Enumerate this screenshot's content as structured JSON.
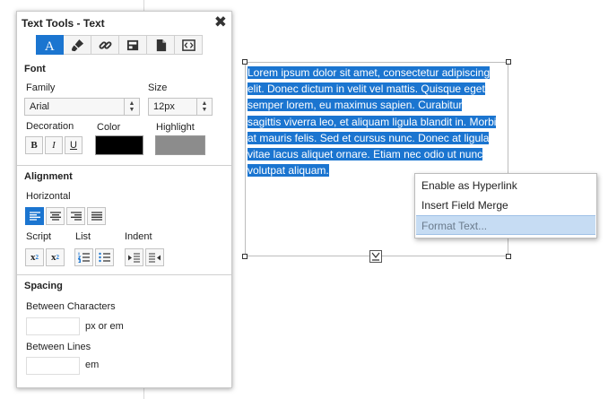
{
  "panel": {
    "title": "Text Tools - Text",
    "close_glyph": "✖",
    "tabs": [
      {
        "icon": "text-font-icon",
        "active": true
      },
      {
        "icon": "paint-brush-icon",
        "active": false
      },
      {
        "icon": "link-icon",
        "active": false
      },
      {
        "icon": "field-merge-icon",
        "active": false
      },
      {
        "icon": "document-icon",
        "active": false
      },
      {
        "icon": "code-source-icon",
        "active": false
      }
    ],
    "font": {
      "heading": "Font",
      "family_label": "Family",
      "family_value": "Arial",
      "size_label": "Size",
      "size_value": "12px",
      "decoration_label": "Decoration",
      "bold": "B",
      "italic": "I",
      "underline": "U",
      "color_label": "Color",
      "color_value": "#000000",
      "highlight_label": "Highlight",
      "highlight_value": "#8c8c8c"
    },
    "alignment": {
      "heading": "Alignment",
      "horizontal_label": "Horizontal",
      "horizontal_active": "left",
      "script_label": "Script",
      "list_label": "List",
      "indent_label": "Indent",
      "superscript": "x",
      "superscript_mark": "2",
      "subscript": "x",
      "subscript_mark": "2"
    },
    "spacing": {
      "heading": "Spacing",
      "between_characters_label": "Between Characters",
      "between_characters_value": "",
      "chars_unit": "px or em",
      "between_lines_label": "Between Lines",
      "between_lines_value": "",
      "lines_unit": "em"
    }
  },
  "canvas": {
    "lines": [
      "Lorem ipsum dolor sit amet, consectetur adipiscing",
      "elit. Donec dictum in velit vel mattis. Quisque eget",
      "semper lorem, eu maximus sapien. Curabitur",
      "sagittis viverra leo, et aliquam ligula blandit in. Morbi",
      "at mauris felis. Sed et cursus nunc. Donec at ligula",
      "vitae lacus aliquet ornare. Etiam nec odio ut nunc",
      "volutpat aliquam."
    ]
  },
  "context_menu": {
    "items": [
      {
        "label": "Enable as Hyperlink",
        "highlighted": false
      },
      {
        "label": "Insert Field Merge",
        "highlighted": false
      },
      {
        "label": "Format Text...",
        "highlighted": true
      }
    ]
  },
  "colors": {
    "accent": "#1b75d0",
    "selection": "#1b75d0",
    "menu_highlight": "#c6dcf3"
  }
}
